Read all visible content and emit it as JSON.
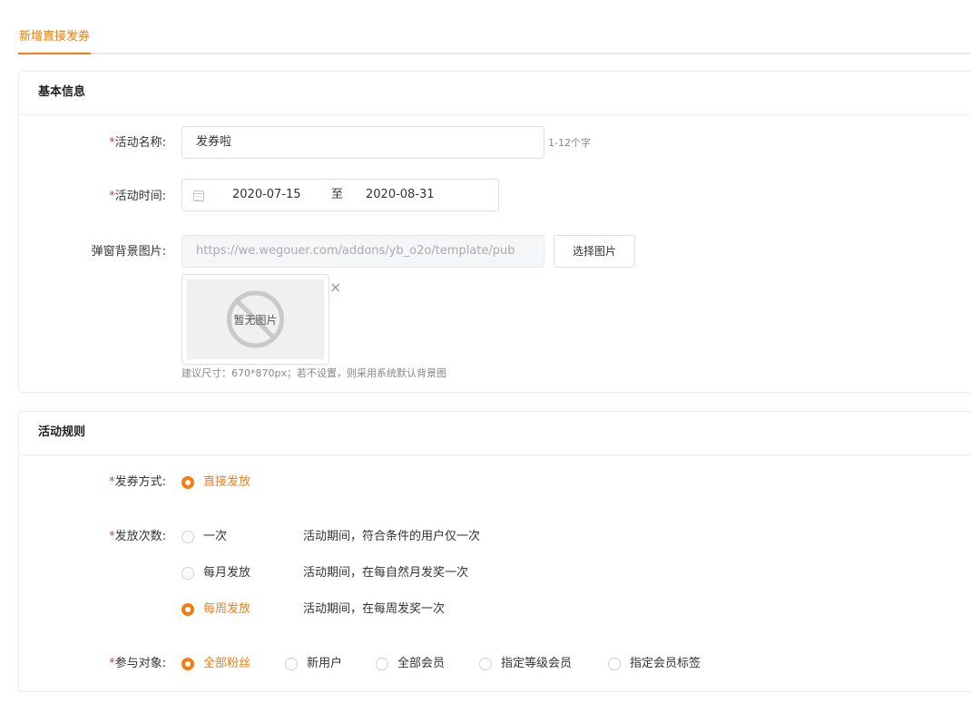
{
  "tabs": {
    "active": "新增直接发券"
  },
  "basic": {
    "title": "基本信息",
    "name": {
      "required": "*",
      "label": "活动名称:",
      "value": "发券啦",
      "hint": "1-12个字"
    },
    "time": {
      "required": "*",
      "label": "活动时间:",
      "start": "2020-07-15",
      "separator": "至",
      "end": "2020-08-31"
    },
    "bg": {
      "label": "弹窗背景图片:",
      "url": "https://we.wegouer.com/addons/yb_o2o/template/pub",
      "button": "选择图片",
      "placeholder": "暂无图片",
      "close": "×",
      "hint": "建议尺寸：670*870px；若不设置，则采用系统默认背景图"
    }
  },
  "rules": {
    "title": "活动规则",
    "method": {
      "required": "*",
      "label": "发券方式:",
      "option": "直接发放"
    },
    "times": {
      "required": "*",
      "label": "发放次数:",
      "options": [
        {
          "label": "一次",
          "desc": "活动期间，符合条件的用户仅一次",
          "checked": false
        },
        {
          "label": "每月发放",
          "desc": "活动期间，在每自然月发奖一次",
          "checked": false
        },
        {
          "label": "每周发放",
          "desc": "活动期间，在每周发奖一次",
          "checked": true
        }
      ]
    },
    "target": {
      "required": "*",
      "label": "参与对象:",
      "options": [
        "全部粉丝",
        "新用户",
        "全部会员",
        "指定等级会员",
        "指定会员标签"
      ],
      "selected": "全部粉丝"
    }
  },
  "colors": {
    "accent": "#f57c10",
    "required": "#e53935"
  }
}
